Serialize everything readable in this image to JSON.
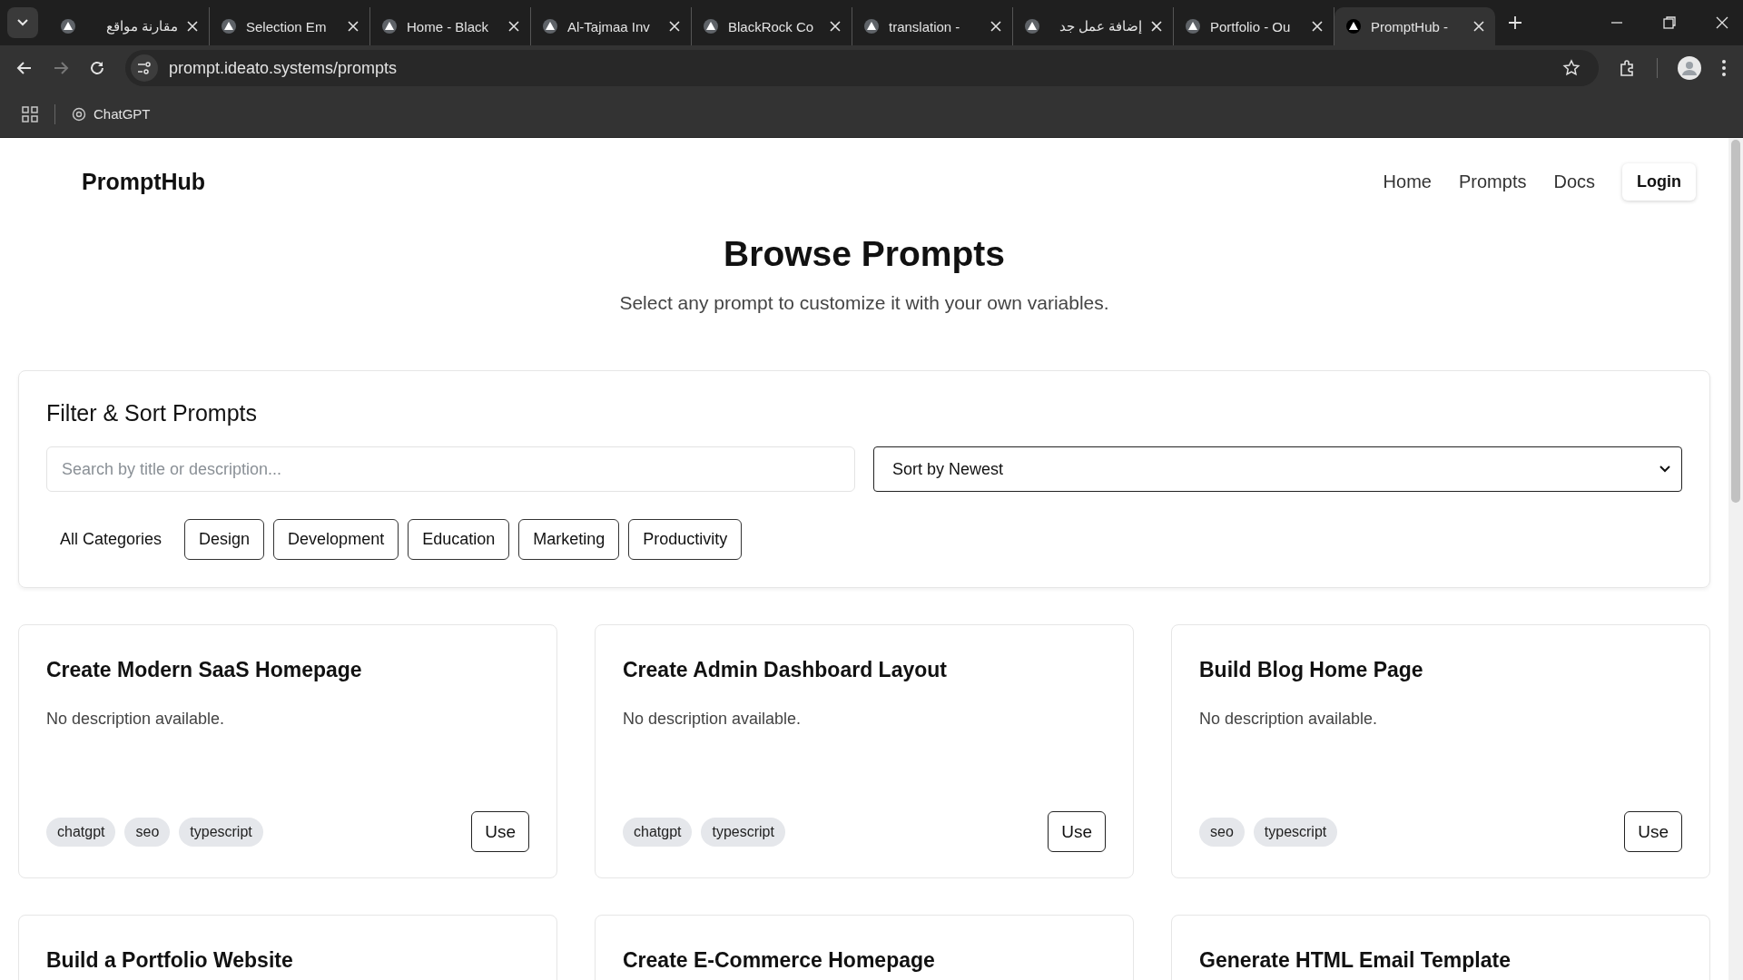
{
  "browser": {
    "tabs": [
      {
        "title": "مقارنة مواقع",
        "selected": false
      },
      {
        "title": "Selection Em",
        "selected": false
      },
      {
        "title": "Home - Black",
        "selected": false
      },
      {
        "title": "Al-Tajmaa Inv",
        "selected": false
      },
      {
        "title": "BlackRock Co",
        "selected": false
      },
      {
        "title": "translation - ",
        "selected": false
      },
      {
        "title": "إضافة عمل جد",
        "selected": false
      },
      {
        "title": "Portfolio - Ou",
        "selected": false
      },
      {
        "title": "PromptHub -",
        "selected": true
      }
    ],
    "url": "prompt.ideato.systems/prompts",
    "bookmarks": [
      {
        "label": "ChatGPT"
      }
    ]
  },
  "page": {
    "brand": "PromptHub",
    "nav": [
      {
        "label": "Home",
        "kind": "link"
      },
      {
        "label": "Prompts",
        "kind": "link"
      },
      {
        "label": "Docs",
        "kind": "link"
      },
      {
        "label": "Login",
        "kind": "button"
      }
    ],
    "heading": "Browse Prompts",
    "subtitle": "Select any prompt to customize it with your own variables.",
    "filter": {
      "title": "Filter & Sort Prompts",
      "search": {
        "placeholder": "Search by title or description..."
      },
      "sort": {
        "value": "Sort by Newest"
      },
      "categories": [
        {
          "label": "All Categories",
          "selected": true
        },
        {
          "label": "Design",
          "selected": false
        },
        {
          "label": "Development",
          "selected": false
        },
        {
          "label": "Education",
          "selected": false
        },
        {
          "label": "Marketing",
          "selected": false
        },
        {
          "label": "Productivity",
          "selected": false
        }
      ]
    },
    "prompts": [
      {
        "title": "Create Modern SaaS Homepage",
        "description": "No description available.",
        "tags": [
          "chatgpt",
          "seo",
          "typescript"
        ],
        "action": "Use"
      },
      {
        "title": "Create Admin Dashboard Layout",
        "description": "No description available.",
        "tags": [
          "chatgpt",
          "typescript"
        ],
        "action": "Use"
      },
      {
        "title": "Build Blog Home Page",
        "description": "No description available.",
        "tags": [
          "seo",
          "typescript"
        ],
        "action": "Use"
      },
      {
        "title": "Build a Portfolio Website"
      },
      {
        "title": "Create E-Commerce Homepage"
      },
      {
        "title": "Generate HTML Email Template"
      }
    ]
  }
}
